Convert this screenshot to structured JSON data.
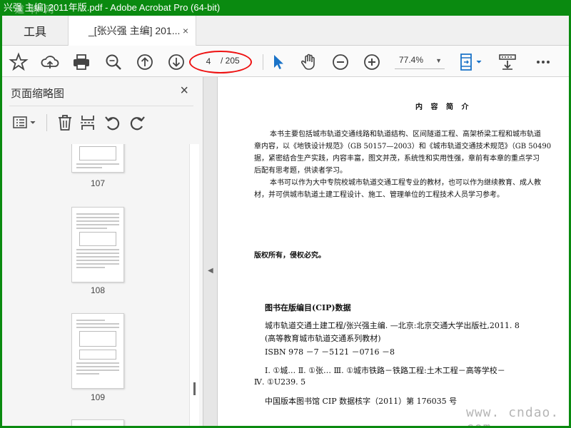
{
  "window": {
    "title": "兴强 主编] 2011年版.pdf - Adobe Acrobat Pro (64-bit)"
  },
  "tabs": {
    "tools_label": "工具",
    "document_label": "_[张兴强 主编] 201...",
    "close_glyph": "×"
  },
  "toolbar": {
    "icons": [
      "star-icon",
      "cloud-upload-icon",
      "print-icon",
      "zoom-search-icon",
      "page-up-icon",
      "page-down-icon",
      "select-arrow-icon",
      "hand-icon",
      "zoom-out-icon",
      "zoom-in-icon",
      "page-fit-icon",
      "scroll-mode-icon",
      "more-icon"
    ],
    "page_current": "4",
    "page_total": "/ 205",
    "zoom": "77.4%",
    "accent_color": "#1a73c8",
    "highlight_color": "#e11111"
  },
  "sidebar": {
    "title": "页面缩略图",
    "close_glyph": "×",
    "tool_icons": [
      "thumbnail-options-icon",
      "delete-icon",
      "extract-icon",
      "rotate-ccw-icon",
      "rotate-cw-icon"
    ],
    "thumbnails": [
      {
        "label": "107"
      },
      {
        "label": "108"
      },
      {
        "label": "109"
      }
    ]
  },
  "document": {
    "heading": "内 容 简 介",
    "summary_lines": [
      "本书主要包括城市轨道交通线路和轨道结构、区间隧道工程、高架桥梁工程和城市轨道",
      "章内容，以《地铁设计规范》（GB 50157—2003）和《城市轨道交通技术规范》（GB 50490",
      "据，紧密结合生产实践，内容丰富，图文并茂，系统性和实用性强，章前有本章的重点学习",
      "后配有思考题，供读者学习。",
      "本书可以作为大中专院校城市轨道交通工程专业的教材，也可以作为继续教育、成人教",
      "材，并可供城市轨道土建工程设计、施工、管理单位的工程技术人员学习参考。"
    ],
    "copyright": "版权所有，侵权必究。",
    "cip_title": "图书在版编目(CIP)数据",
    "cip_lines": [
      "城市轨道交通土建工程/张兴强主编. —北京:北京交通大学出版社,2011. 8",
      "(高等教育城市轨道交通系列教材)",
      "ISBN 978 －7 －5121 －0716 －8",
      "Ⅰ. ①城…   Ⅱ. ①张…   Ⅲ. ①城市铁路－铁路工程:土木工程－高等学校－",
      "Ⅳ. ①U239. 5",
      "中国版本图书馆 CIP 数据核字（2011）第 176035 号"
    ]
  },
  "watermarks": {
    "logo": "道 林 网",
    "site": "www. cndao. com"
  }
}
